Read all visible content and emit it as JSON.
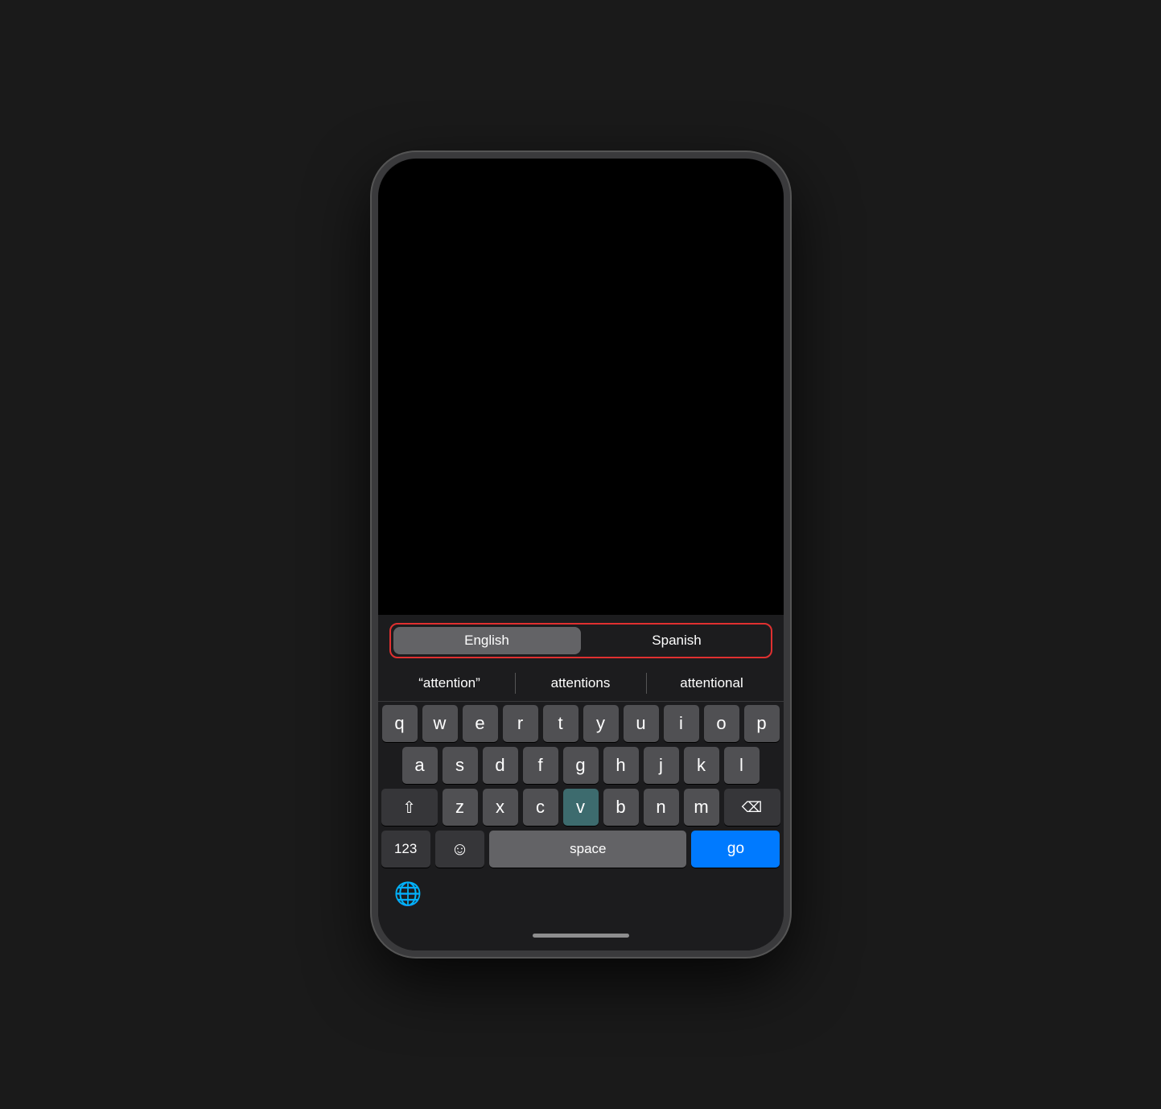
{
  "languages": {
    "english": "English",
    "spanish": "Spanish"
  },
  "autocomplete": {
    "item1": "“attention”",
    "item2": "attentions",
    "item3": "attentional"
  },
  "keyboard": {
    "row1": [
      "q",
      "w",
      "e",
      "r",
      "t",
      "y",
      "u",
      "i",
      "o",
      "p"
    ],
    "row2": [
      "a",
      "s",
      "d",
      "f",
      "g",
      "h",
      "j",
      "k",
      "l"
    ],
    "row3": [
      "z",
      "x",
      "c",
      "v",
      "b",
      "n",
      "m"
    ],
    "bottom": {
      "numbers": "123",
      "emoji": "☺",
      "space": "space",
      "go": "go"
    }
  },
  "home_indicator": "",
  "globe_icon": "🌐"
}
